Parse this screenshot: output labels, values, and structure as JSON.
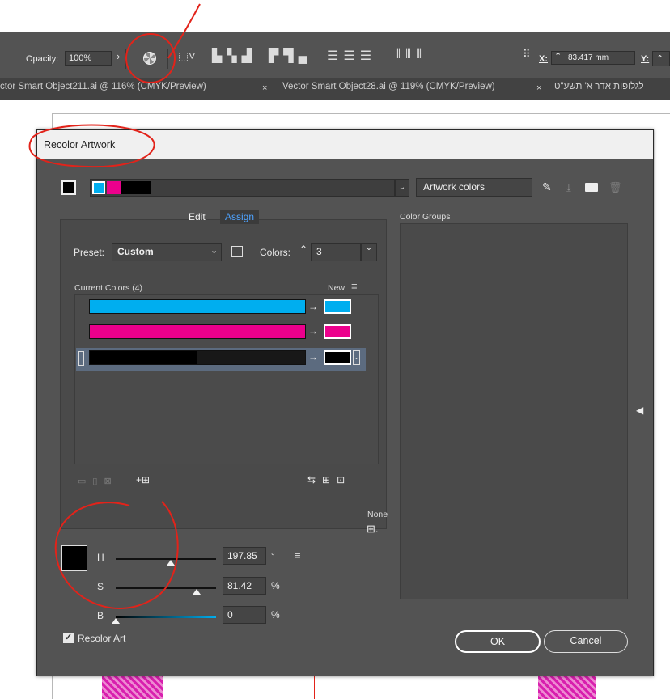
{
  "control_bar": {
    "opacity_label": "Opacity:",
    "opacity_value": "100%",
    "x_label": "X:",
    "x_value": "83.417 mm",
    "y_label": "Y:"
  },
  "tabs": [
    {
      "label": "ctor Smart Object211.ai @ 116% (CMYK/Preview)"
    },
    {
      "label": "Vector Smart Object28.ai @ 119% (CMYK/Preview)"
    },
    {
      "label": "לגלופות אדר א' תשע\"ט"
    }
  ],
  "tab_close": "×",
  "dialog": {
    "title": "Recolor Artwork",
    "artwork_colors_label": "Artwork colors",
    "color_groups_label": "Color Groups",
    "edit_tab": "Edit",
    "assign_tab": "Assign",
    "preset_label": "Preset:",
    "preset_value": "Custom",
    "colors_label": "Colors:",
    "colors_value": "3",
    "current_colors_label": "Current Colors (4)",
    "new_label": "New",
    "none_label": "None",
    "hsb": {
      "h_label": "H",
      "h_value": "197.85",
      "h_unit": "°",
      "s_label": "S",
      "s_value": "81.42",
      "s_unit": "%",
      "b_label": "B",
      "b_value": "0",
      "b_unit": "%",
      "h_level": 0.55,
      "s_level": 0.81,
      "b_level": 0.0
    },
    "recolor_art_label": "Recolor Art",
    "recolor_art_checked": true,
    "ok_label": "OK",
    "cancel_label": "Cancel"
  },
  "colors": {
    "cyan": "#00aeef",
    "magenta": "#ec008c",
    "black": "#000000",
    "annotation": "#e2231a"
  },
  "icons": [
    "recolor-wheel-icon",
    "eyedropper-icon",
    "folder-icon",
    "trash-icon",
    "hamburger-menu-icon",
    "arrow-right-icon",
    "collapse-arrow-icon"
  ]
}
